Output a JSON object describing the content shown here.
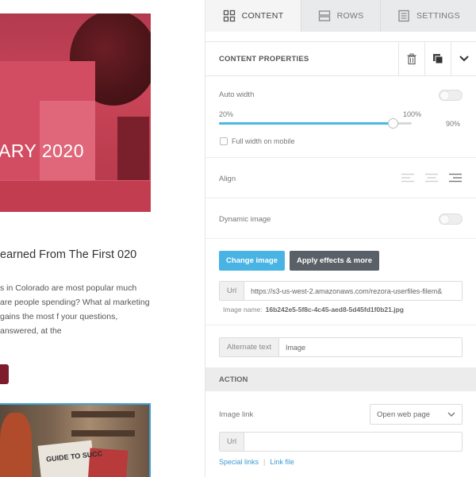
{
  "canvas": {
    "hero_text": "ARY 2020",
    "post_title": "earned From The First 020",
    "post_body": "s in Colorado are most popular much are people spending? What al marketing gains the most f your questions, answered, at the",
    "photo_book_text": "GUIDE TO SUCC"
  },
  "tabs": [
    {
      "label": "CONTENT",
      "icon": "grid-icon",
      "active": true
    },
    {
      "label": "ROWS",
      "icon": "rows-icon",
      "active": false
    },
    {
      "label": "SETTINGS",
      "icon": "settings-doc-icon",
      "active": false
    }
  ],
  "content_properties": {
    "title": "CONTENT PROPERTIES",
    "actions": [
      "trash-icon",
      "duplicate-icon",
      "collapse-chevron-icon"
    ]
  },
  "auto_width": {
    "label": "Auto width",
    "enabled": false,
    "slider_min_label": "20%",
    "slider_max_label": "100%",
    "value_label": "90%",
    "value_fraction": 0.9,
    "full_width_mobile_label": "Full width on mobile",
    "full_width_mobile_checked": false
  },
  "align": {
    "label": "Align",
    "options": [
      "align-left-icon",
      "align-center-icon",
      "align-right-icon"
    ],
    "selected": "align-right-icon"
  },
  "dynamic_image": {
    "label": "Dynamic image",
    "enabled": false
  },
  "image_buttons": {
    "change_label": "Change image",
    "effects_label": "Apply effects & more"
  },
  "url_field": {
    "prefix": "Url",
    "value": "https://s3-us-west-2.amazonaws.com/rezora-userfiles-filem&"
  },
  "image_name": {
    "label": "Image name:",
    "value": "16b242e5-5f8c-4c45-aed8-5d45fd1f0b21.jpg"
  },
  "alt_text": {
    "prefix": "Alternate text",
    "value": "Image"
  },
  "action": {
    "title": "ACTION",
    "image_link_label": "Image link",
    "link_type": "Open web page",
    "url_prefix": "Url",
    "url_value": "",
    "special_links": "Special links",
    "separator": "|",
    "link_file": "Link file"
  },
  "colors": {
    "accent_blue": "#49b4e3",
    "dark_button": "#5a6068",
    "hero_red": "#c94457"
  }
}
